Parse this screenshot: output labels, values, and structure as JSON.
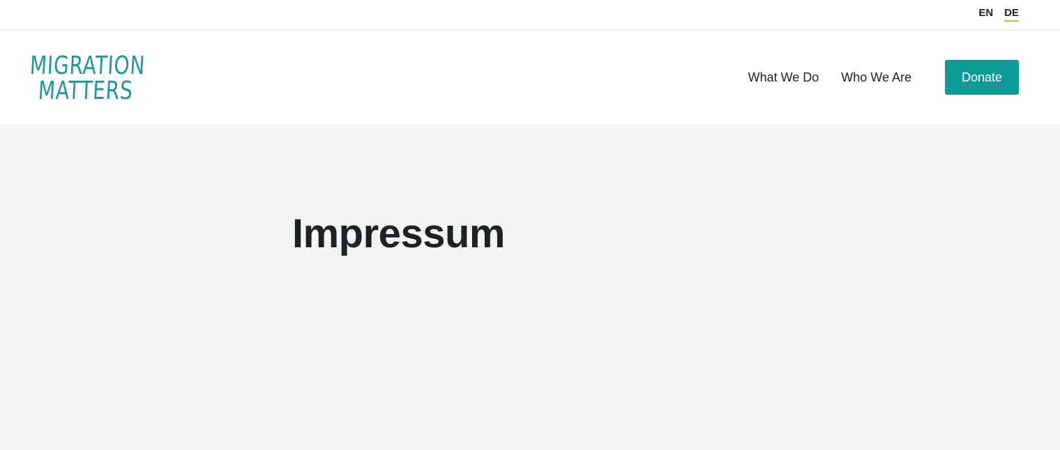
{
  "language_bar": {
    "items": [
      {
        "label": "EN",
        "active": false
      },
      {
        "label": "DE",
        "active": true
      }
    ],
    "active_underline_color": "#b8d21a"
  },
  "header": {
    "logo": {
      "line1": "MIGRATION",
      "line2": "MATTERS",
      "color": "#1e9a99"
    },
    "nav": {
      "items": [
        {
          "label": "What We Do"
        },
        {
          "label": "Who We Are"
        }
      ],
      "donate_label": "Donate",
      "donate_color": "#0f9b95"
    }
  },
  "main": {
    "title": "Impressum",
    "background_color": "#f3f5f4"
  }
}
